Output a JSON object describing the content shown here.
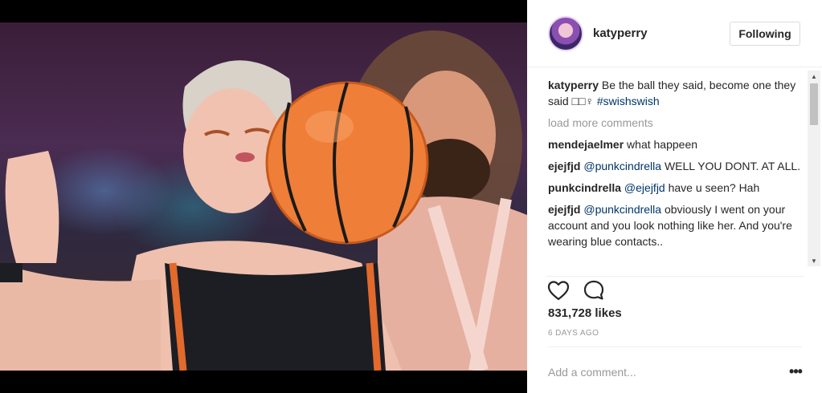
{
  "post": {
    "username": "katyperry",
    "follow_label": "Following",
    "likes": "831,728 likes",
    "timestamp": "6 DAYS AGO",
    "add_comment_placeholder": "Add a comment...",
    "more_options_glyph": "•••"
  },
  "caption": {
    "user": "katyperry",
    "text": " Be the ball they said, become one they said □□♀ ",
    "hashtag": "#swishswish"
  },
  "load_more": "load more comments",
  "comments": [
    {
      "user": "mendejaelmer",
      "mention": "",
      "text": " what happeen"
    },
    {
      "user": "ejejfjd",
      "mention": " @punkcindrella",
      "text": " WELL YOU DONT. AT ALL."
    },
    {
      "user": "punkcindrella",
      "mention": " @ejejfjd",
      "text": " have u seen? Hah"
    },
    {
      "user": "ejejfjd",
      "mention": " @punkcindrella",
      "text": " obviously I went on your account and you look nothing like her. And you're wearing blue contacts.."
    }
  ],
  "icons": {
    "like": "heart-icon",
    "comment": "comment-bubble-icon",
    "avatar": "avatar-image",
    "scroll_up": "scroll-up-arrow-icon",
    "scroll_down": "scroll-down-arrow-icon"
  },
  "colors": {
    "link": "#003569",
    "muted": "#999999",
    "border": "#efefef",
    "text": "#262626"
  }
}
